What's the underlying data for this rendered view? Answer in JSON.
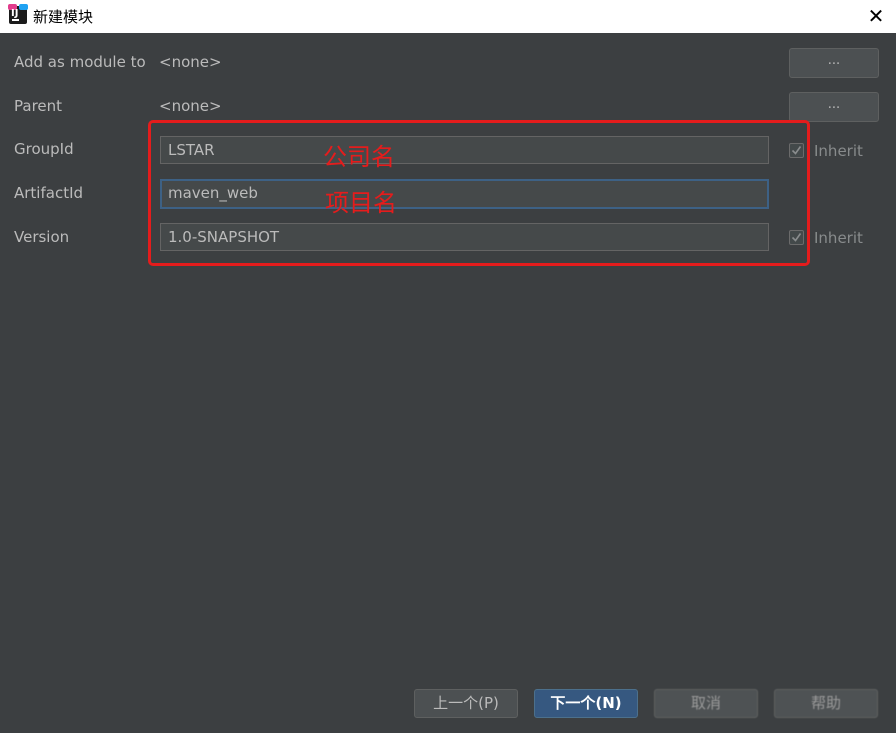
{
  "window": {
    "title": "新建模块",
    "close_glyph": "✕",
    "app_icon": "intellij-idea-icon",
    "app_icon_text": "IJ"
  },
  "form": {
    "add_as_module_to": {
      "label": "Add as module to",
      "value": "<none>",
      "button": "..."
    },
    "parent": {
      "label": "Parent",
      "value": "<none>",
      "button": "..."
    },
    "group_id": {
      "label": "GroupId",
      "value": "LSTAR",
      "inherit_label": "Inherit",
      "inherit_checked": true
    },
    "artifact_id": {
      "label": "ArtifactId",
      "value": "maven_web"
    },
    "version": {
      "label": "Version",
      "value": "1.0-SNAPSHOT",
      "inherit_label": "Inherit",
      "inherit_checked": true
    }
  },
  "annotations": {
    "group_note": "公司名",
    "artifact_note": "项目名",
    "highlight_color": "#e51c1c"
  },
  "buttons": {
    "previous": "上一个(P)",
    "next": "下一个(N)",
    "cancel": "取消",
    "help": "帮助"
  },
  "colors": {
    "background": "#3c3f41",
    "primary_button": "#365880",
    "focus_border": "#3d6185"
  }
}
